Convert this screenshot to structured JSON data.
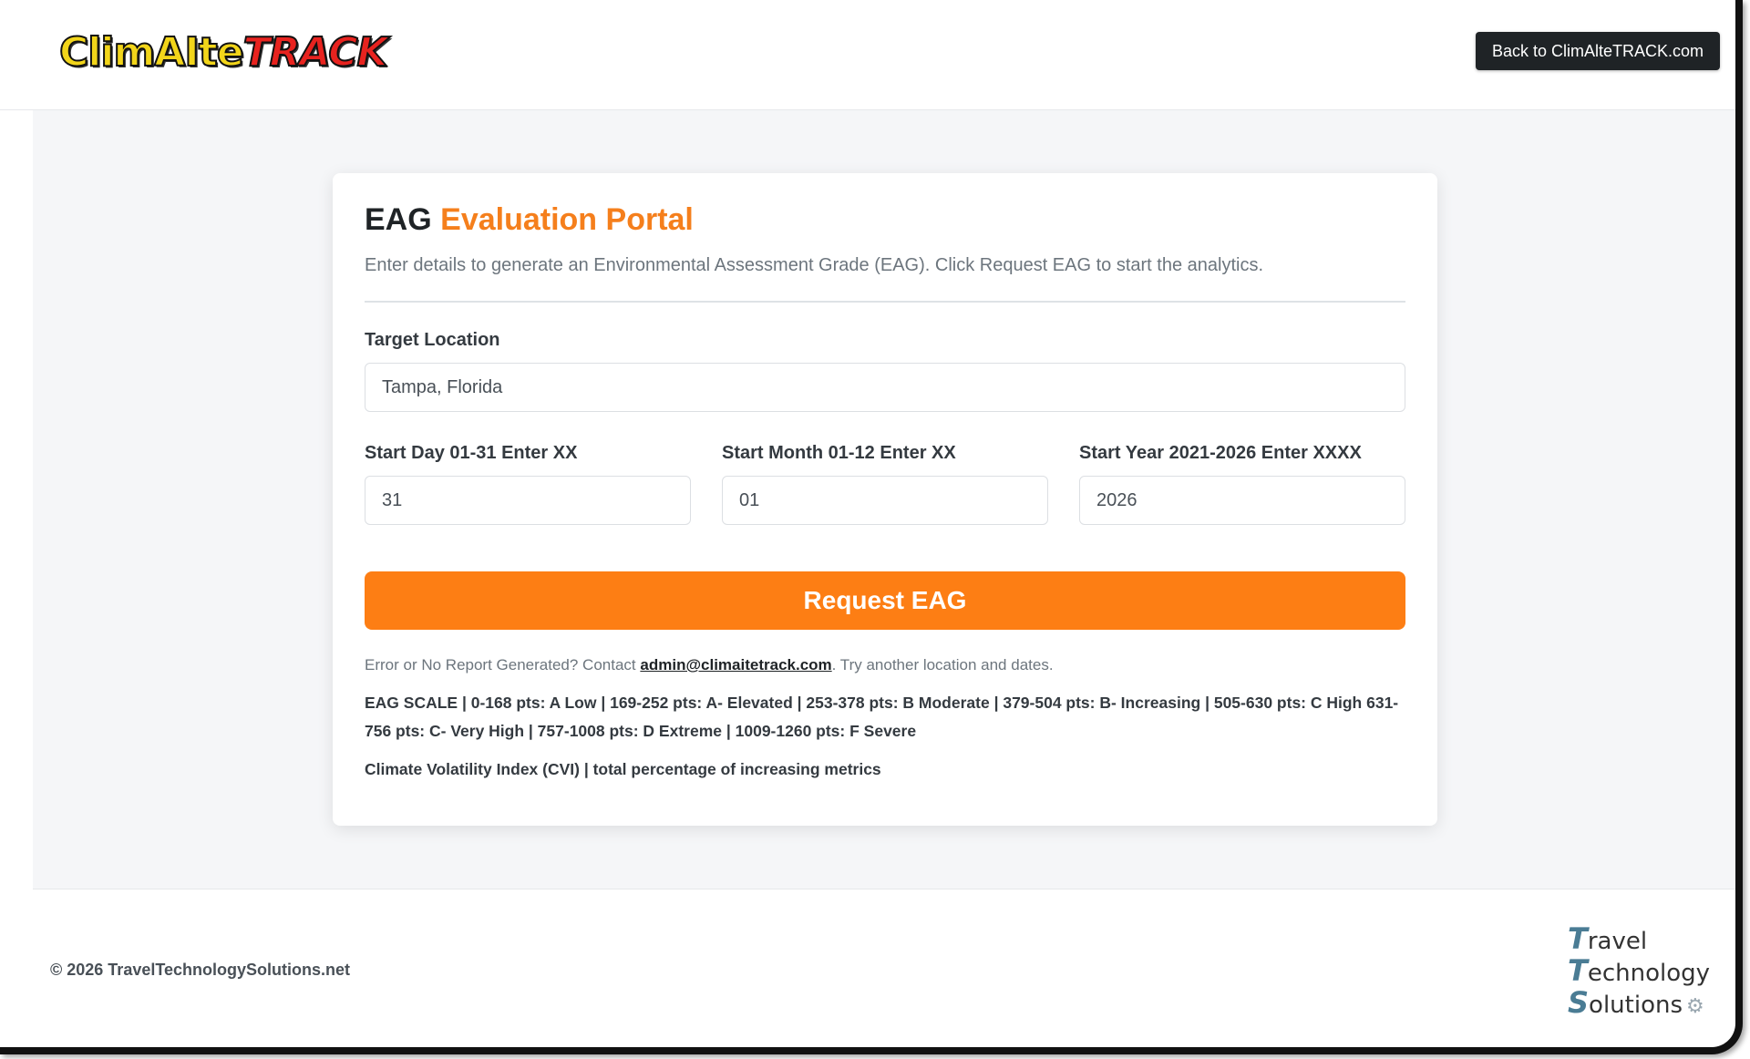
{
  "header": {
    "logo_part1": "ClimAIte",
    "logo_part2": "TRACK",
    "back_button": "Back to ClimAlteTRACK.com"
  },
  "card": {
    "title_prefix": "EAG",
    "title_accent": "Evaluation Portal",
    "subtitle": "Enter details to generate an Environmental Assessment Grade (EAG). Click Request EAG to start the analytics.",
    "location_label": "Target Location",
    "location_value": "Tampa, Florida",
    "day_label": "Start Day 01-31 Enter XX",
    "day_value": "31",
    "month_label": "Start Month 01-12 Enter XX",
    "month_value": "01",
    "year_label": "Start Year 2021-2026 Enter XXXX",
    "year_value": "2026",
    "request_button": "Request EAG",
    "note_prefix": "Error or No Report Generated? Contact",
    "note_email": "admin@climaitetrack.com",
    "note_suffix": ". Try another location and dates.",
    "scale": "EAG SCALE | 0-168 pts: A Low | 169-252 pts: A- Elevated | 253-378 pts: B Moderate | 379-504 pts: B- Increasing | 505-630 pts: C High 631-756 pts: C- Very High | 757-1008 pts: D Extreme | 1009-1260 pts: F Severe",
    "cvi": "Climate Volatility Index (CVI) | total percentage of increasing metrics"
  },
  "footer": {
    "copyright": "© 2026 TravelTechnologySolutions.net",
    "brand_t1": "T",
    "brand_w1": "ravel",
    "brand_t2": "T",
    "brand_w2": "echnology",
    "brand_t3": "S",
    "brand_w3": "olutions"
  },
  "colors": {
    "accent": "#fd7e14",
    "dark": "#1f2326"
  }
}
